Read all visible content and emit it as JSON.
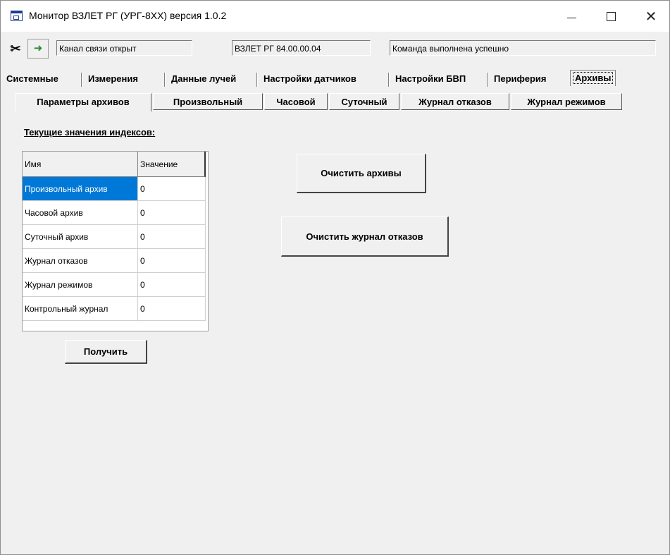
{
  "window": {
    "title": "Монитор ВЗЛЕТ РГ (УРГ-8XX) версия 1.0.2",
    "min_glyph": "—",
    "max_glyph": "☐",
    "close_glyph": "✕"
  },
  "statusbar": {
    "disconnect_icon": "disconnect-icon",
    "connect_icon": "connect-icon",
    "channel_status": "Канал связи открыт",
    "device": "ВЗЛЕТ РГ 84.00.00.04",
    "command_status": "Команда выполнена успешно"
  },
  "tabs": [
    {
      "label": "Системные"
    },
    {
      "label": "Измерения"
    },
    {
      "label": "Данные лучей"
    },
    {
      "label": "Настройки датчиков"
    },
    {
      "label": "Настройки БВП"
    },
    {
      "label": "Периферия"
    },
    {
      "label": "Архивы"
    }
  ],
  "subtabs": [
    {
      "label": "Параметры архивов"
    },
    {
      "label": "Произвольный"
    },
    {
      "label": "Часовой"
    },
    {
      "label": "Суточный"
    },
    {
      "label": "Журнал отказов"
    },
    {
      "label": "Журнал режимов"
    }
  ],
  "indices": {
    "section_label": "Текущие значения индексов:",
    "columns": [
      "Имя",
      "Значение"
    ],
    "rows": [
      {
        "name": "Произвольный архив",
        "value": "0"
      },
      {
        "name": "Часовой архив",
        "value": "0"
      },
      {
        "name": "Суточный архив",
        "value": "0"
      },
      {
        "name": "Журнал отказов",
        "value": "0"
      },
      {
        "name": "Журнал режимов",
        "value": "0"
      },
      {
        "name": "Контрольный журнал",
        "value": "0"
      }
    ],
    "get_button": "Получить"
  },
  "actions": {
    "clear_archives": "Очистить архивы",
    "clear_fault_log": "Очистить журнал отказов"
  },
  "colors": {
    "selection": "#0078d7",
    "background": "#f0f0f0"
  }
}
